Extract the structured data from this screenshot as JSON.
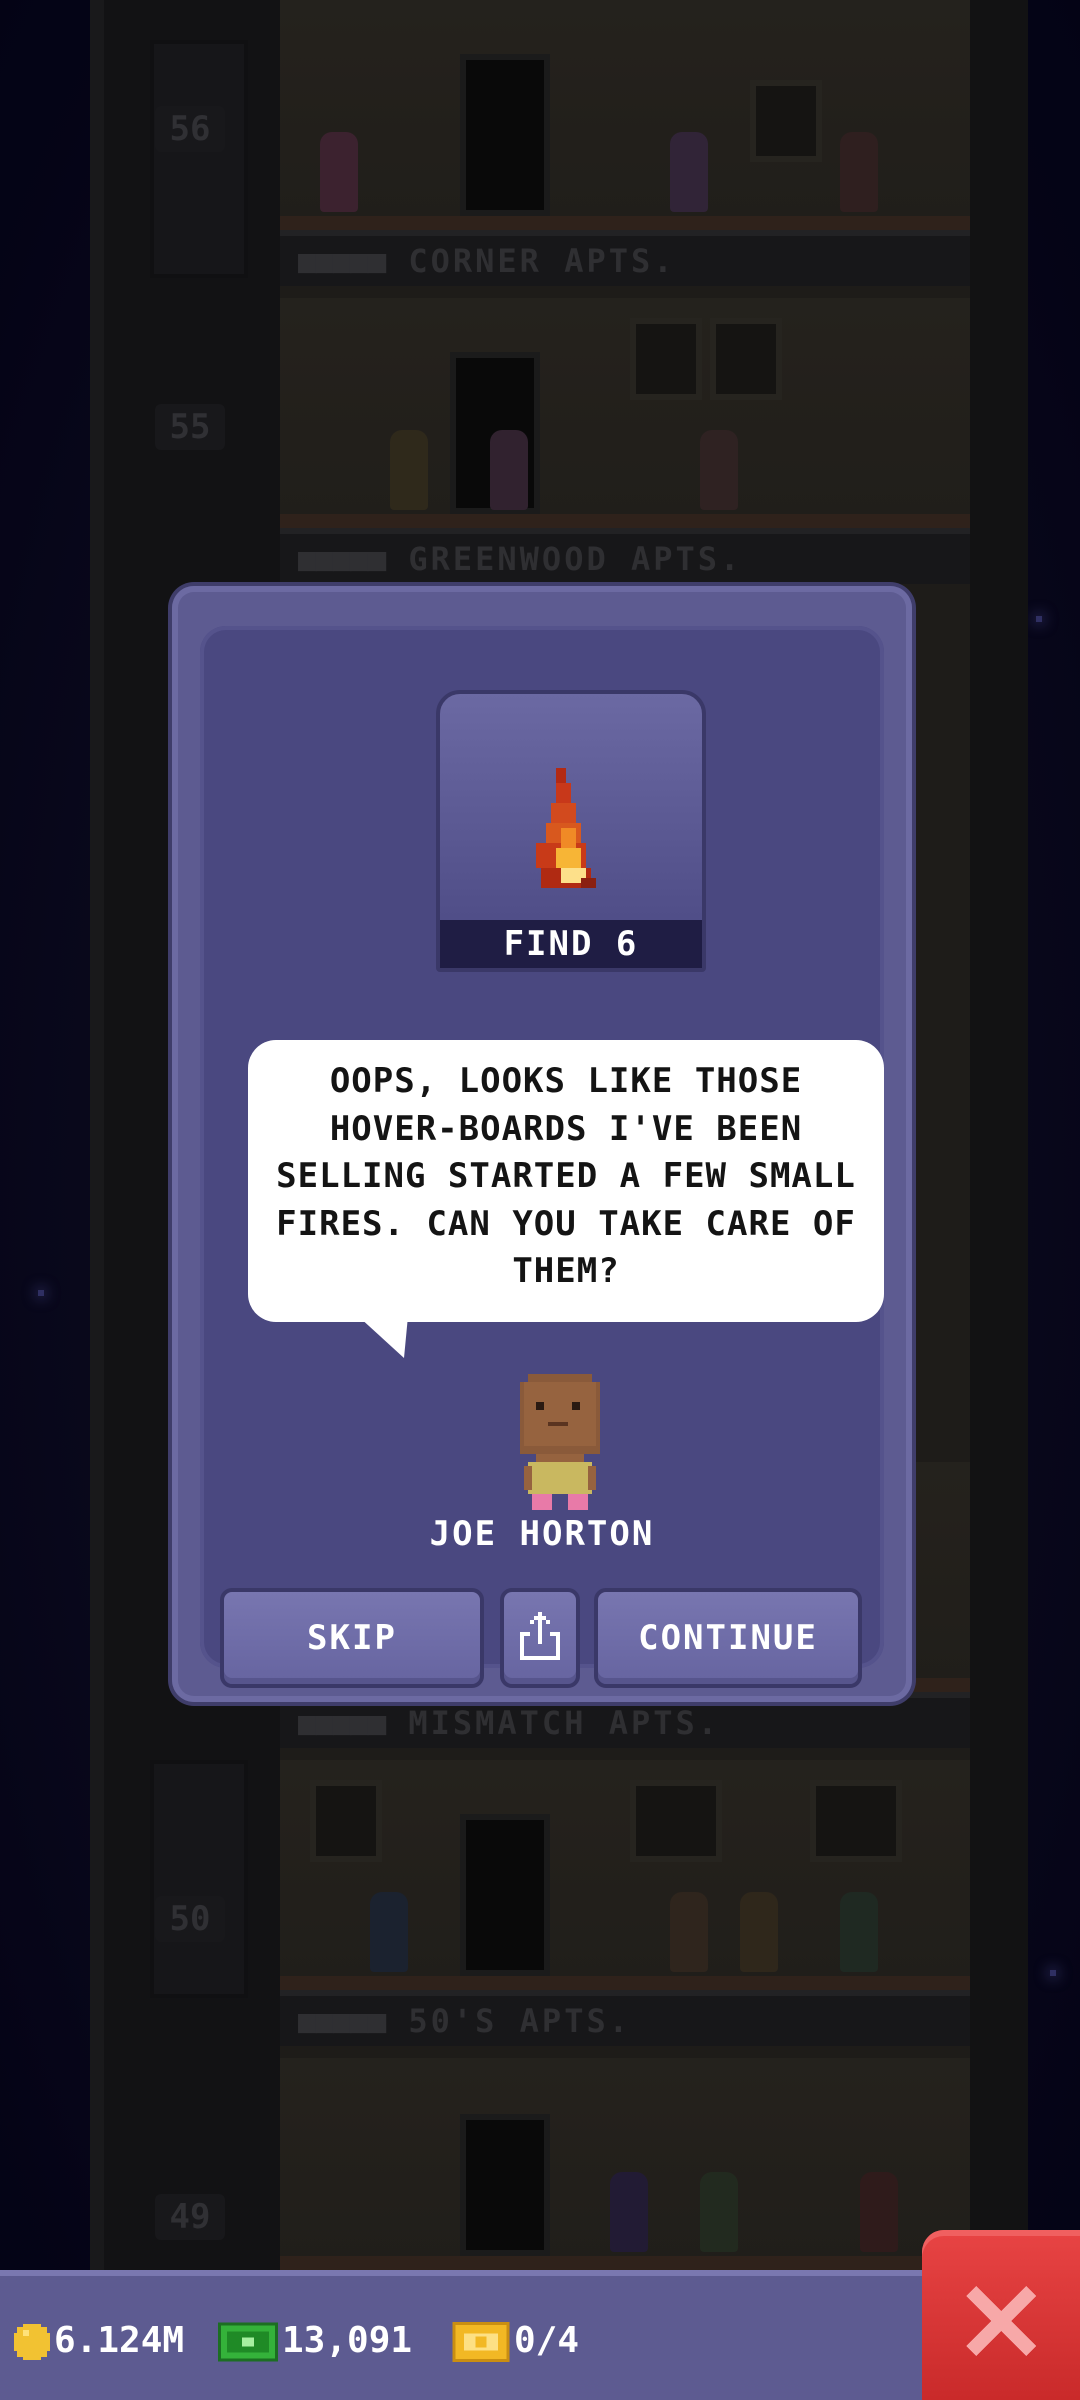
{
  "tower": {
    "floors": [
      {
        "number": "56",
        "label": "CORNER APTS."
      },
      {
        "number": "55",
        "label": "GREENWOOD APTS."
      },
      {
        "number": "",
        "label": "MISMATCH APTS."
      },
      {
        "number": "50",
        "label": "50'S APTS."
      },
      {
        "number": "49",
        "label": ""
      }
    ]
  },
  "dialog": {
    "quest_label": "FIND 6",
    "quest_icon": "fire-icon",
    "message": "OOPS, LOOKS LIKE THOSE HOVER-BOARDS I'VE BEEN SELLING STARTED A FEW SMALL FIRES. CAN YOU TAKE CARE OF THEM?",
    "npc_name": "JOE HORTON",
    "skip_label": "SKIP",
    "share_icon": "share-icon",
    "continue_label": "CONTINUE"
  },
  "status": {
    "coins": "6.124M",
    "bux": "13,091",
    "tickets": "0/4"
  },
  "colors": {
    "panel": "#5d5b91",
    "panel_inner": "#4a4880",
    "close_button": "#d63434",
    "quest_label_bg": "#1f1d44"
  }
}
